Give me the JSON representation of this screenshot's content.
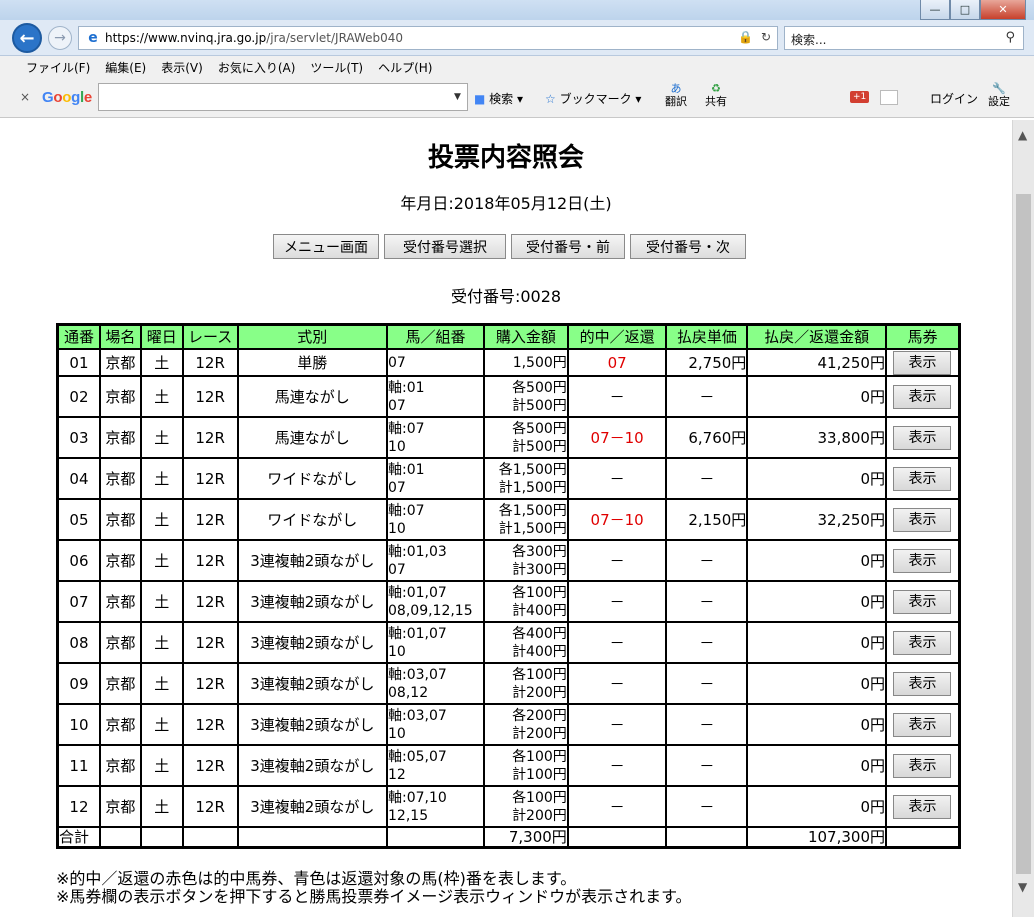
{
  "browser": {
    "url_host": "https://www.nvinq.jra.go.jp",
    "url_path": "/jra/servlet/JRAWeb040",
    "search_placeholder": "検索..."
  },
  "menu": [
    "ファイル(F)",
    "編集(E)",
    "表示(V)",
    "お気に入り(A)",
    "ツール(T)",
    "ヘルプ(H)"
  ],
  "google_toolbar": {
    "logo": "Google",
    "search": "検索",
    "bookmarks": "ブックマーク",
    "translate": "翻訳",
    "share": "共有",
    "plus": "+1",
    "login": "ログイン",
    "settings": "設定"
  },
  "page": {
    "title": "投票内容照会",
    "date_line": "年月日:2018年05月12日(土)",
    "buttons": [
      "メニュー画面",
      "受付番号選択",
      "受付番号・前",
      "受付番号・次"
    ],
    "receipt_line": "受付番号:0028"
  },
  "table": {
    "headers": [
      "通番",
      "場名",
      "曜日",
      "レース",
      "式別",
      "馬／組番",
      "購入金額",
      "的中／返還",
      "払戻単価",
      "払戻／返還金額",
      "馬券"
    ],
    "rows": [
      {
        "no": "01",
        "venue": "京都",
        "day": "土",
        "race": "12R",
        "type": "単勝",
        "horse1": "07",
        "horse2": "",
        "amt1": "1,500円",
        "amt2": "",
        "hit": "07",
        "unit": "2,750円",
        "payout": "41,250円",
        "btn": "表示"
      },
      {
        "no": "02",
        "venue": "京都",
        "day": "土",
        "race": "12R",
        "type": "馬連ながし",
        "horse1": "軸:01",
        "horse2": "07",
        "amt1": "各500円",
        "amt2": "計500円",
        "hit": "－",
        "unit": "－",
        "payout": "0円",
        "btn": "表示"
      },
      {
        "no": "03",
        "venue": "京都",
        "day": "土",
        "race": "12R",
        "type": "馬連ながし",
        "horse1": "軸:07",
        "horse2": "10",
        "amt1": "各500円",
        "amt2": "計500円",
        "hit": "07－10",
        "unit": "6,760円",
        "payout": "33,800円",
        "btn": "表示"
      },
      {
        "no": "04",
        "venue": "京都",
        "day": "土",
        "race": "12R",
        "type": "ワイドながし",
        "horse1": "軸:01",
        "horse2": "07",
        "amt1": "各1,500円",
        "amt2": "計1,500円",
        "hit": "－",
        "unit": "－",
        "payout": "0円",
        "btn": "表示"
      },
      {
        "no": "05",
        "venue": "京都",
        "day": "土",
        "race": "12R",
        "type": "ワイドながし",
        "horse1": "軸:07",
        "horse2": "10",
        "amt1": "各1,500円",
        "amt2": "計1,500円",
        "hit": "07－10",
        "unit": "2,150円",
        "payout": "32,250円",
        "btn": "表示"
      },
      {
        "no": "06",
        "venue": "京都",
        "day": "土",
        "race": "12R",
        "type": "3連複軸2頭ながし",
        "horse1": "軸:01,03",
        "horse2": "07",
        "amt1": "各300円",
        "amt2": "計300円",
        "hit": "－",
        "unit": "－",
        "payout": "0円",
        "btn": "表示"
      },
      {
        "no": "07",
        "venue": "京都",
        "day": "土",
        "race": "12R",
        "type": "3連複軸2頭ながし",
        "horse1": "軸:01,07",
        "horse2": "08,09,12,15",
        "amt1": "各100円",
        "amt2": "計400円",
        "hit": "－",
        "unit": "－",
        "payout": "0円",
        "btn": "表示"
      },
      {
        "no": "08",
        "venue": "京都",
        "day": "土",
        "race": "12R",
        "type": "3連複軸2頭ながし",
        "horse1": "軸:01,07",
        "horse2": "10",
        "amt1": "各400円",
        "amt2": "計400円",
        "hit": "－",
        "unit": "－",
        "payout": "0円",
        "btn": "表示"
      },
      {
        "no": "09",
        "venue": "京都",
        "day": "土",
        "race": "12R",
        "type": "3連複軸2頭ながし",
        "horse1": "軸:03,07",
        "horse2": "08,12",
        "amt1": "各100円",
        "amt2": "計200円",
        "hit": "－",
        "unit": "－",
        "payout": "0円",
        "btn": "表示"
      },
      {
        "no": "10",
        "venue": "京都",
        "day": "土",
        "race": "12R",
        "type": "3連複軸2頭ながし",
        "horse1": "軸:03,07",
        "horse2": "10",
        "amt1": "各200円",
        "amt2": "計200円",
        "hit": "－",
        "unit": "－",
        "payout": "0円",
        "btn": "表示"
      },
      {
        "no": "11",
        "venue": "京都",
        "day": "土",
        "race": "12R",
        "type": "3連複軸2頭ながし",
        "horse1": "軸:05,07",
        "horse2": "12",
        "amt1": "各100円",
        "amt2": "計100円",
        "hit": "－",
        "unit": "－",
        "payout": "0円",
        "btn": "表示"
      },
      {
        "no": "12",
        "venue": "京都",
        "day": "土",
        "race": "12R",
        "type": "3連複軸2頭ながし",
        "horse1": "軸:07,10",
        "horse2": "12,15",
        "amt1": "各100円",
        "amt2": "計200円",
        "hit": "－",
        "unit": "－",
        "payout": "0円",
        "btn": "表示"
      }
    ],
    "total": {
      "label": "合計",
      "amount": "7,300円",
      "payout": "107,300円"
    }
  },
  "notes": [
    "※的中／返還の赤色は的中馬券、青色は返還対象の馬(枠)番を表します。",
    "※馬券欄の表示ボタンを押下すると勝馬投票券イメージ表示ウィンドウが表示されます。"
  ],
  "colors": {
    "header_bg": "#88ff88",
    "hit_text": "#e00000"
  }
}
